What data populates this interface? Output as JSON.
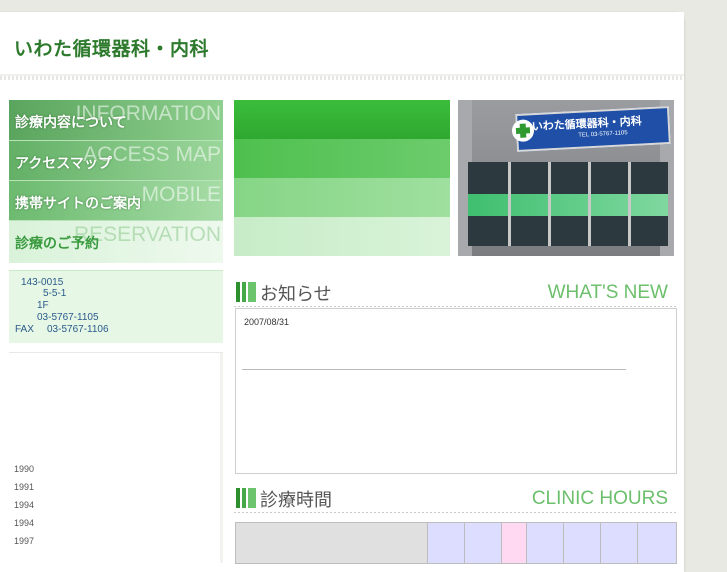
{
  "header": {
    "title": "いわた循環器科・内科"
  },
  "nav": {
    "items": [
      {
        "jp": "診療内容について",
        "en": "INFORMATION"
      },
      {
        "jp": "アクセスマップ",
        "en": "ACCESS MAP"
      },
      {
        "jp": "携帯サイトのご案内",
        "en": "MOBILE"
      },
      {
        "jp": "診療のご予約",
        "en": "RESERVATION"
      }
    ]
  },
  "address": {
    "postal": "143-0015",
    "street": "5-5-1",
    "floor": "1F",
    "tel": "03-5767-1105",
    "fax_label": "FAX",
    "fax": "03-5767-1106"
  },
  "history": {
    "years": [
      "1990",
      "1991",
      "1994",
      "1994",
      "1997"
    ]
  },
  "photo": {
    "sign_text": "いわた循環器科・内科",
    "sign_tel": "TEL 03-5767-1105"
  },
  "news": {
    "heading_jp": "お知らせ",
    "heading_en": "WHAT'S NEW",
    "date": "2007/08/31"
  },
  "hours": {
    "heading_jp": "診療時間",
    "heading_en": "CLINIC HOURS"
  },
  "colors": {
    "brand_green": "#2d7a2d",
    "accent_green": "#6cbf6c",
    "nav_green": "#6ab86e"
  }
}
